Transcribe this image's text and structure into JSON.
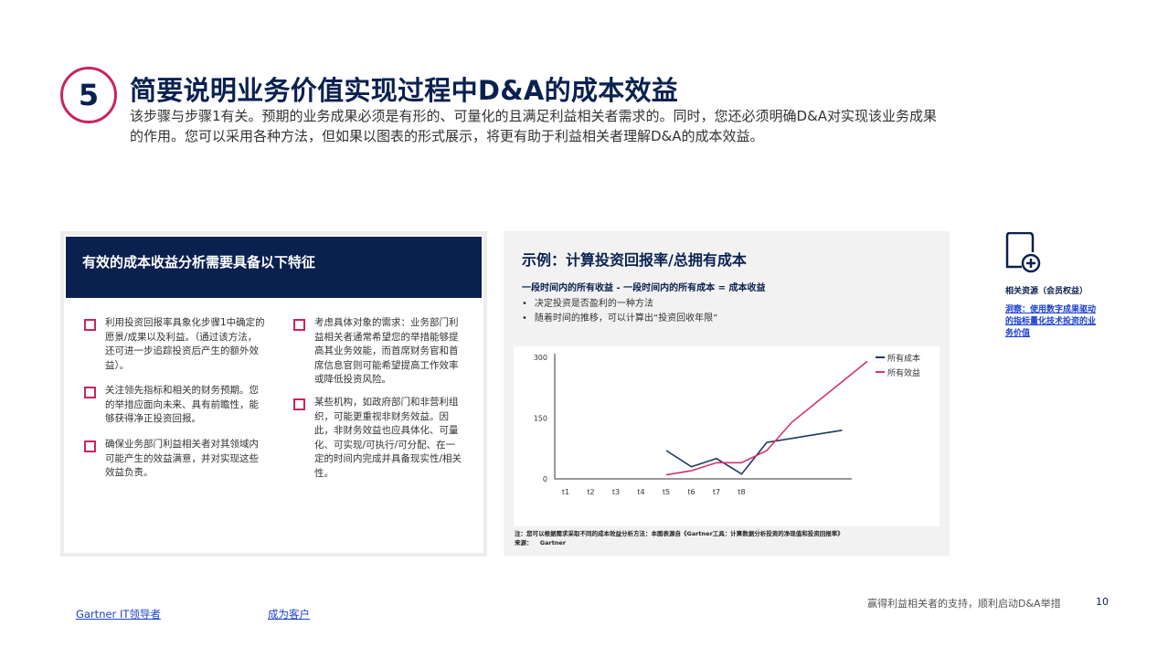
{
  "header": {
    "step_number": "5",
    "title": "简要说明业务价值实现过程中D&A的成本效益",
    "description": "该步骤与步骤1有关。预期的业务成果必须是有形的、可量化的且满足利益相关者需求的。同时，您还必须明确D&A对实现该业务成果的作用。您可以采用各种方法，但如果以图表的形式展示，将更有助于利益相关者理解D&A的成本效益。"
  },
  "left_panel": {
    "title": "有效的成本收益分析需要具备以下特征",
    "items": [
      "利用投资回报率具象化步骤1中确定的愿景/成果以及利益。（通过该方法，还可进一步追踪投资后产生的额外效益）。",
      "关注领先指标和相关的财务预期。您的举措应面向未来、具有前瞻性，能够获得净正投资回报。",
      "确保业务部门利益相关者对其领域内可能产生的效益满意，并对实现这些效益负责。",
      "考虑具体对象的需求：业务部门利益相关者通常希望您的举措能够提高其业务效能，而首席财务官和首席信息官则可能希望提高工作效率或降低投资风险。",
      "某些机构，如政府部门和非营利组织，可能更重视非财务效益。因此，非财务效益也应具体化、可量化、可实现/可执行/可分配、在一定的时间内完成并具备现实性/相关性。"
    ]
  },
  "example_panel": {
    "title": "示例：计算投资回报率/总拥有成本",
    "formula": "一段时间内的所有收益 - 一段时间内的所有成本 = 成本收益",
    "bullets": [
      "决定投资是否盈利的一种方法",
      "随着时间的推移，可以计算出“投资回收年限”"
    ],
    "note": "注：您可以根据需求采取不同的成本效益分析方法：本图表源自《Gartner工具：计算数据分析投资的净现值和投资回报率》",
    "source_label": "来源：",
    "source_value": "Gartner"
  },
  "chart_data": {
    "type": "line",
    "categories": [
      "t1",
      "t2",
      "t3",
      "t4",
      "t5",
      "t6",
      "t7",
      "t8"
    ],
    "y_ticks": [
      "300",
      "150",
      "0"
    ],
    "ylim": [
      0,
      300
    ],
    "x": [
      5,
      6,
      7,
      8,
      9,
      10,
      11,
      12,
      13
    ],
    "series": [
      {
        "name": "所有成本",
        "color": "#1f3864",
        "values": [
          70,
          30,
          50,
          12,
          90,
          100,
          110,
          120,
          null
        ]
      },
      {
        "name": "所有效益",
        "color": "#d6336c",
        "values": [
          10,
          20,
          40,
          40,
          70,
          140,
          190,
          240,
          290
        ]
      }
    ],
    "grid": false,
    "legend": "top-right"
  },
  "resource": {
    "label": "相关资源（会员权益）",
    "link": "洞察：使用数字成果驱动的指标量化技术投资的业务价值"
  },
  "footer": {
    "link_leaders": "Gartner IT领导者",
    "link_customer": "成为客户",
    "caption": "赢得利益相关者的支持，顺利启动D&A举措",
    "page_number": "10"
  }
}
